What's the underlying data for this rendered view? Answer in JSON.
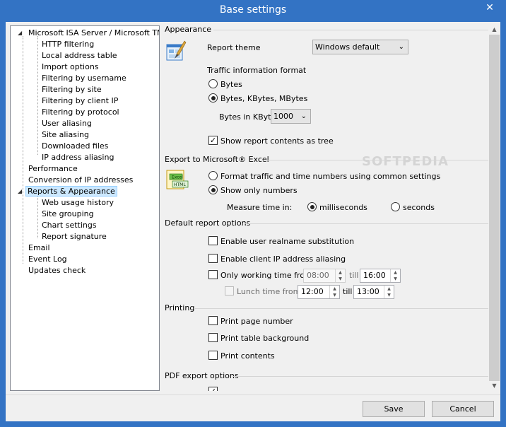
{
  "window": {
    "title": "Base settings",
    "close_glyph": "✕"
  },
  "tree": {
    "root": "Microsoft ISA Server / Microsoft TMG",
    "root_children": [
      "HTTP filtering",
      "Local address table",
      "Import options",
      "Filtering by username",
      "Filtering by site",
      "Filtering by client IP",
      "Filtering by protocol",
      "User aliasing",
      "Site aliasing",
      "Downloaded files",
      "IP address aliasing"
    ],
    "performance": "Performance",
    "conversion": "Conversion of IP addresses",
    "reports": "Reports & Appearance",
    "reports_children": [
      "Web usage history",
      "Site grouping",
      "Chart settings",
      "Report signature"
    ],
    "email": "Email",
    "event_log": "Event Log",
    "updates": "Updates check",
    "expanded_glyph": "◢"
  },
  "appearance": {
    "title": "Appearance",
    "icon": "paint-brush-icon",
    "theme_label": "Report theme",
    "theme_value": "Windows default",
    "traffic_format_label": "Traffic information format",
    "opt_bytes": "Bytes",
    "opt_kbytes": "Bytes, KBytes, MBytes",
    "selected_format": "kbytes",
    "kbyte_label": "Bytes in KByte",
    "kbyte_value": "1000",
    "tree_check_label": "Show report contents as tree",
    "tree_check": true
  },
  "excel": {
    "title": "Export to Microsoft® Excel",
    "icon": "excel-html-icon",
    "icon_text_top": "Excel",
    "icon_text_bottom": "HTML",
    "opt_format": "Format traffic and time numbers using common settings",
    "opt_numbers": "Show only numbers",
    "selected": "numbers",
    "measure_label": "Measure time in:",
    "opt_ms": "milliseconds",
    "opt_sec": "seconds",
    "selected_measure": "milliseconds"
  },
  "defaults": {
    "title": "Default report options",
    "realname_label": "Enable user realname substitution",
    "ip_alias_label": "Enable client IP address aliasing",
    "working_label": "Only working time from",
    "work_from": "08:00",
    "till_label": "till",
    "work_till": "16:00",
    "lunch_label": "Lunch time from",
    "lunch_from": "12:00",
    "lunch_till_label": "till",
    "lunch_till": "13:00"
  },
  "printing": {
    "title": "Printing",
    "page_number_label": "Print page number",
    "table_bg_label": "Print table background",
    "contents_label": "Print contents"
  },
  "pdf": {
    "title": "PDF export options"
  },
  "buttons": {
    "save": "Save",
    "cancel": "Cancel"
  },
  "checkmark": "✓",
  "scroll": {
    "up": "▲",
    "down": "▼"
  },
  "select_arrow": "⌄",
  "spin_up": "▲",
  "spin_down": "▼",
  "watermark": "SOFTPEDIA"
}
